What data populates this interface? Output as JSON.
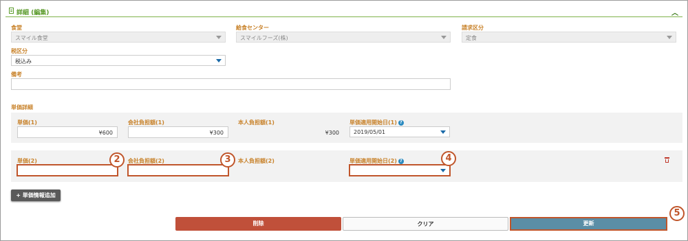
{
  "header": {
    "title": "詳細 (編集)"
  },
  "fields": {
    "shokudo": {
      "label": "食堂",
      "value": "スマイル食堂"
    },
    "kyushoku": {
      "label": "給食センター",
      "value": "スマイルフーズ(株)"
    },
    "seikyu": {
      "label": "請求区分",
      "value": "定食"
    },
    "zei": {
      "label": "税区分",
      "value": "税込み"
    },
    "biko": {
      "label": "備考",
      "value": ""
    }
  },
  "section_title": "単価詳細",
  "row1": {
    "tanka_label": "単価(1)",
    "tanka_value": "¥600",
    "kaisha_label": "会社負担額(1)",
    "kaisha_value": "¥300",
    "honnin_label": "本人負担額(1)",
    "honnin_value": "¥300",
    "date_label": "単価適用開始日(1)",
    "date_value": "2019/05/01"
  },
  "row2": {
    "tanka_label": "単価(2)",
    "tanka_value": "",
    "kaisha_label": "会社負担額(2)",
    "kaisha_value": "",
    "honnin_label": "本人負担額(2)",
    "honnin_value": "",
    "date_label": "単価適用開始日(2)",
    "date_value": ""
  },
  "help_glyph": "?",
  "callouts": [
    "2",
    "3",
    "4",
    "5"
  ],
  "add_button": "+ 単価情報追加",
  "buttons": {
    "delete": "削除",
    "clear": "クリア",
    "update": "更新"
  },
  "colors": {
    "label": "#c8822a",
    "header_green": "#5a9a2a",
    "delete_bg": "#c0503a",
    "update_bg": "#5b8ea6",
    "callout": "#c0552a"
  }
}
